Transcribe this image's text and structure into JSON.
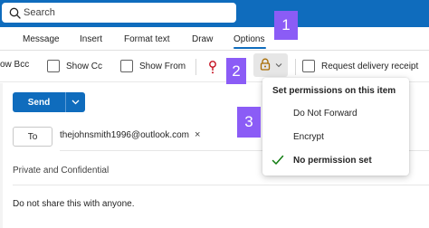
{
  "search": {
    "placeholder": "Search"
  },
  "tabs": [
    {
      "label": "Message"
    },
    {
      "label": "Insert"
    },
    {
      "label": "Format text"
    },
    {
      "label": "Draw"
    },
    {
      "label": "Options",
      "active": true
    }
  ],
  "toolbar": {
    "show_bcc": "ow Bcc",
    "show_cc": "Show Cc",
    "show_from": "Show From",
    "importance_icon": "exclamation-icon",
    "permissions_icon": "lock-icon",
    "request_delivery_receipt": "Request delivery receipt"
  },
  "badges": [
    "1",
    "2",
    "3"
  ],
  "compose": {
    "send_label": "Send",
    "to_label": "To",
    "recipient": "thejohnsmith1996@outlook.com",
    "sensitivity": "Private and Confidential",
    "body": "Do not share this with anyone."
  },
  "permissions_menu": {
    "header": "Set permissions on this item",
    "items": [
      {
        "label": "Do Not Forward",
        "selected": false
      },
      {
        "label": "Encrypt",
        "selected": false
      },
      {
        "label": "No permission set",
        "selected": true
      }
    ]
  },
  "colors": {
    "accent": "#0f6cbd",
    "badge": "#8b5cf6",
    "check": "#107c10",
    "importance": "#c50f1f",
    "lock": "#a86b00"
  }
}
